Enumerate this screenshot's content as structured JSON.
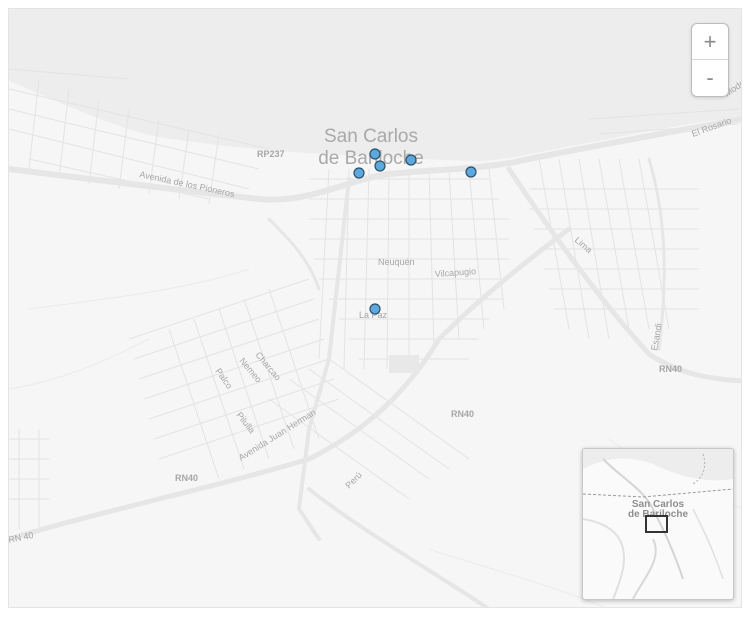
{
  "map": {
    "city_label_line1": "San Carlos",
    "city_label_line2": "de Bariloche",
    "road_labels": {
      "rp237": "RP237",
      "pioneros": "Avenida de los Pioneros",
      "neuquen": "Neuquén",
      "vilcapugio": "Vilcapugio",
      "la_paz": "La Paz",
      "lima": "Lima",
      "esandi": "Esandi",
      "el_rosario": "El Rosario",
      "charcao": "Charcao",
      "nemeo": "Nemeo",
      "palco": "Palco",
      "pilulla": "Pilulla",
      "juan_herman": "Avenida Juan Herman",
      "peru": "Perú",
      "rn40_a": "RN40",
      "rn40_b": "RN40",
      "rn40_c": "RN40",
      "rn40_d": "RN 40",
      "mode": "Mode"
    },
    "marker_color": "#5da8dc",
    "marker_count": 6
  },
  "zoom": {
    "in_label": "+",
    "out_label": "-"
  },
  "minimap": {
    "label_line1": "San Carlos",
    "label_line2": "de Bariloche"
  }
}
